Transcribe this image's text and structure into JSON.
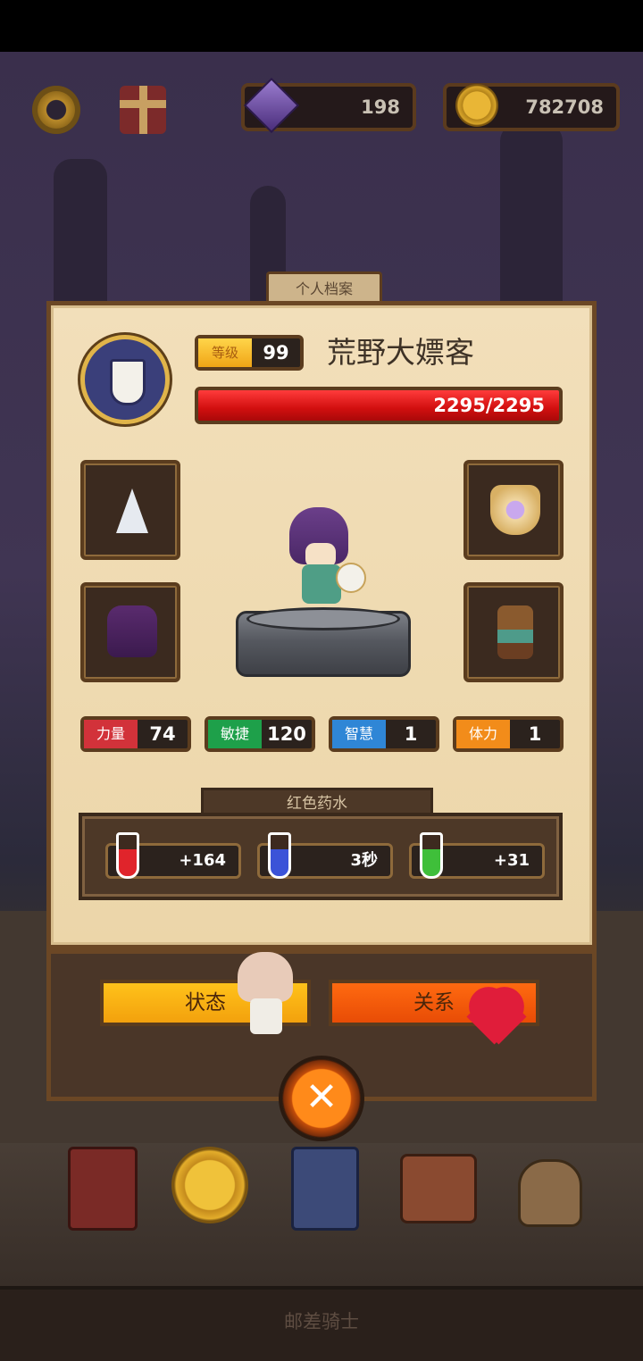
{
  "topbar": {
    "gems": "198",
    "coins": "782708"
  },
  "panel": {
    "tab_label": "个人档案",
    "level_label": "等级",
    "level_value": "99",
    "character_name": "荒野大嫖客",
    "hp_text": "2295/2295",
    "stats": [
      {
        "label": "力量",
        "value": "74",
        "color": "#d2323a"
      },
      {
        "label": "敏捷",
        "value": "120",
        "color": "#1ea04a"
      },
      {
        "label": "智慧",
        "value": "1",
        "color": "#2f86d6"
      },
      {
        "label": "体力",
        "value": "1",
        "color": "#f28c1a"
      }
    ],
    "potion_title": "红色药水",
    "potions": [
      {
        "value": "+164",
        "icon": "health-potion-icon"
      },
      {
        "value": "3秒",
        "icon": "time-potion-icon"
      },
      {
        "value": "+31",
        "icon": "armor-potion-icon"
      }
    ]
  },
  "buttons": {
    "status": "状态",
    "relation": "关系"
  },
  "footer_title": "邮差骑士"
}
